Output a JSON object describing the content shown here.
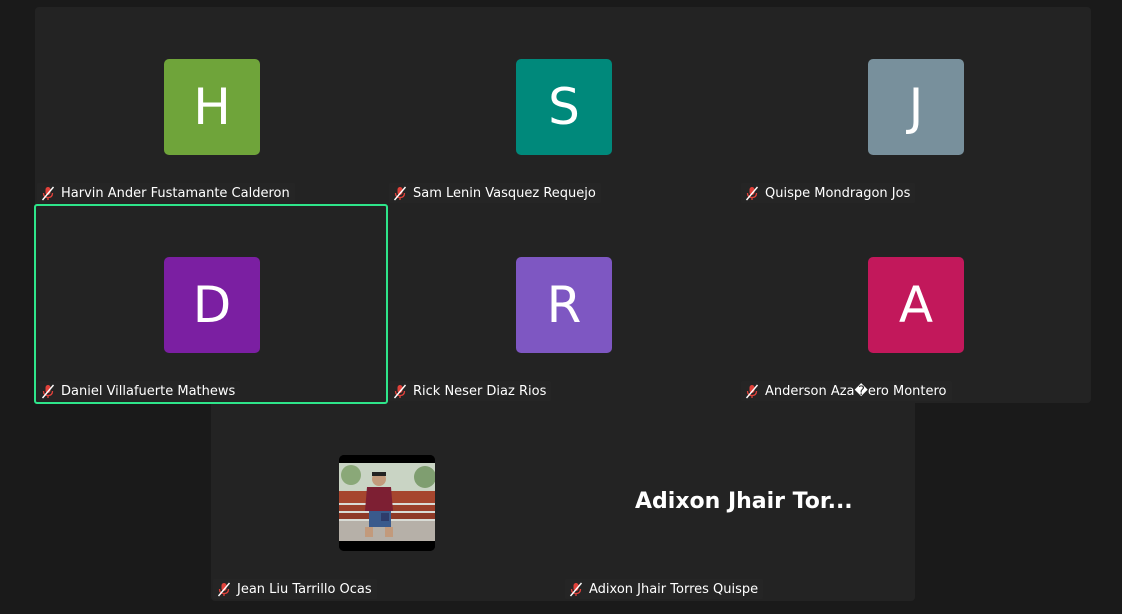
{
  "colors": {
    "background": "#1a1a1a",
    "tile": "#232323",
    "active_speaker_border": "#2ee58a",
    "mute_red": "#e0413a"
  },
  "participants": [
    {
      "initial": "H",
      "name": "Harvin Ander Fustamante Calderon",
      "avatar_color": "#6fa43a",
      "muted": true
    },
    {
      "initial": "S",
      "name": "Sam Lenin Vasquez Requejo",
      "avatar_color": "#00897b",
      "muted": true
    },
    {
      "initial": "J",
      "name": "Quispe Mondragon Jos",
      "avatar_color": "#78909c",
      "muted": true
    },
    {
      "initial": "D",
      "name": "Daniel Villafuerte Mathews",
      "avatar_color": "#7b1fa2",
      "muted": true,
      "active_speaker": true
    },
    {
      "initial": "R",
      "name": "Rick Neser Diaz Rios",
      "avatar_color": "#7e57c2",
      "muted": true
    },
    {
      "initial": "A",
      "name": "Anderson Aza�ero Montero",
      "avatar_color": "#c2185b",
      "muted": true
    },
    {
      "name": "Jean Liu Tarrillo Ocas",
      "muted": true,
      "has_video": true
    },
    {
      "name": "Adixon Jhair Torres Quispe",
      "display_title": "Adixon Jhair Tor...",
      "muted": true
    }
  ]
}
